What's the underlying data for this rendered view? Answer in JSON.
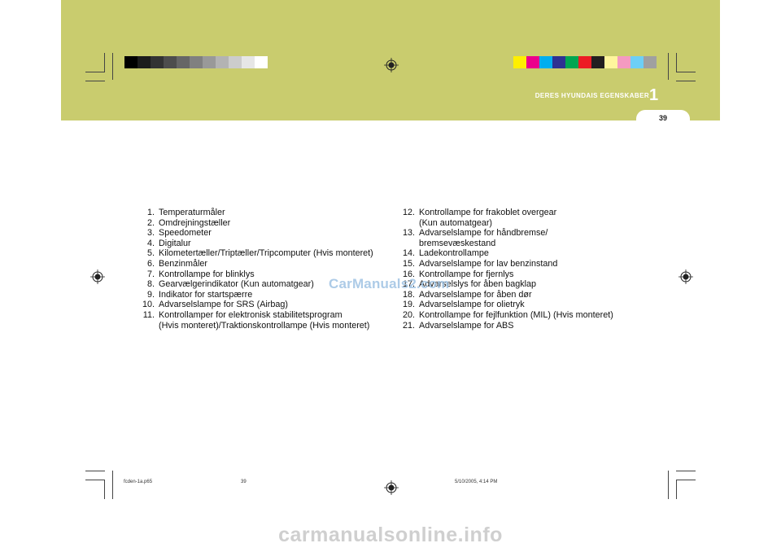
{
  "header": {
    "chapter_title": "DERES HYUNDAIS EGENSKABER",
    "chapter_number": "1",
    "page_number": "39",
    "band_color": "#c9cc6e",
    "left_swatches": [
      "#000000",
      "#1c1c1c",
      "#333333",
      "#4d4d4d",
      "#666666",
      "#808080",
      "#999999",
      "#b3b3b3",
      "#cccccc",
      "#e6e6e6",
      "#ffffff"
    ],
    "right_swatches": [
      "#ffef00",
      "#ec008c",
      "#00aeef",
      "#2e3192",
      "#00a651",
      "#ed1c24",
      "#231f20",
      "#fff59d",
      "#f49ac1",
      "#6dcff6",
      "#a0a0a0"
    ]
  },
  "left_list": [
    {
      "num": "1.",
      "lines": [
        "Temperaturmåler"
      ]
    },
    {
      "num": "2.",
      "lines": [
        "Omdrejningstæller"
      ]
    },
    {
      "num": "3.",
      "lines": [
        "Speedometer"
      ]
    },
    {
      "num": "4.",
      "lines": [
        "Digitalur"
      ]
    },
    {
      "num": "5.",
      "lines": [
        "Kilometertæller/Triptæller/Tripcomputer (Hvis monteret)"
      ]
    },
    {
      "num": "6.",
      "lines": [
        "Benzinmåler"
      ]
    },
    {
      "num": "7.",
      "lines": [
        "Kontrollampe for blinklys"
      ]
    },
    {
      "num": "8.",
      "lines": [
        "Gearvælgerindikator (Kun automatgear)"
      ]
    },
    {
      "num": "9.",
      "lines": [
        "Indikator for startspærre"
      ]
    },
    {
      "num": "10.",
      "lines": [
        "Advarselslampe for SRS (Airbag)"
      ]
    },
    {
      "num": "11.",
      "lines": [
        "Kontrollamper for elektronisk stabilitetsprogram",
        "(Hvis monteret)/Traktionskontrollampe (Hvis monteret)"
      ]
    }
  ],
  "right_list": [
    {
      "num": "12.",
      "lines": [
        "Kontrollampe for frakoblet overgear",
        "(Kun automatgear)"
      ]
    },
    {
      "num": "13.",
      "lines": [
        "Advarselslampe for håndbremse/",
        "bremsevæskestand"
      ]
    },
    {
      "num": "14.",
      "lines": [
        "Ladekontrollampe"
      ]
    },
    {
      "num": "15.",
      "lines": [
        "Advarselslampe for lav benzinstand"
      ]
    },
    {
      "num": "16.",
      "lines": [
        "Kontrollampe for fjernlys"
      ]
    },
    {
      "num": "17.",
      "lines": [
        "Advarselslys for åben bagklap"
      ]
    },
    {
      "num": "18.",
      "lines": [
        "Advarselslampe for åben dør"
      ]
    },
    {
      "num": "19.",
      "lines": [
        "Advarselslampe for olietryk"
      ]
    },
    {
      "num": "20.",
      "lines": [
        "Kontrollampe for fejlfunktion (MIL) (Hvis monteret)"
      ]
    },
    {
      "num": "21.",
      "lines": [
        "Advarselslampe for ABS"
      ]
    }
  ],
  "watermark_site": "CarManuals2.com",
  "footer": {
    "file": "fcden-1a.p65",
    "page": "39",
    "date": "5/10/2005, 4:14 PM"
  },
  "bottom_watermark": "carmanualsonline.info"
}
